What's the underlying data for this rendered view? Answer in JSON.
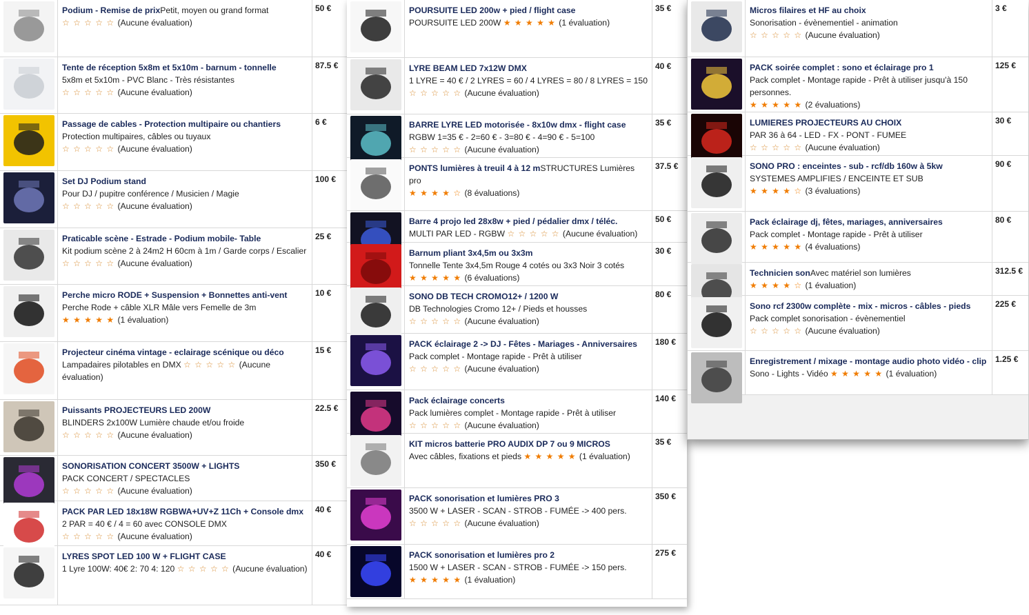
{
  "columns": [
    {
      "items": [
        {
          "title": "Podium - Remise de prix",
          "inline": "Petit, moyen ou grand format",
          "sub": "",
          "rating": "(Aucune évaluation)",
          "stars": 0,
          "price": "50 €",
          "thumb": "podium-thumbnail",
          "colors": [
            "#f4f4f4",
            "#888888"
          ]
        },
        {
          "title": "Tente de réception 5x8m et 5x10m - barnum - tonnelle",
          "inline": "",
          "sub": "5x8m et 5x10m - PVC Blanc - Très résistantes",
          "rating": "(Aucune évaluation)",
          "stars": 0,
          "price": "87.5 €",
          "thumb": "tent-thumbnail",
          "colors": [
            "#f2f3f5",
            "#c9ccd2"
          ]
        },
        {
          "title": "Passage de cables - Protection multipaire ou chantiers",
          "inline": "",
          "sub": "Protection multipaires, câbles ou tuyaux",
          "rating": "(Aucune évaluation)",
          "stars": 0,
          "price": "6 €",
          "thumb": "cable-protector-thumbnail",
          "colors": [
            "#f2c300",
            "#1c1c1c"
          ]
        },
        {
          "title": "Set DJ Podium stand",
          "inline": "",
          "sub": "Pour DJ / pupitre conférence / Musicien / Magie",
          "rating": "(Aucune évaluation)",
          "stars": 0,
          "price": "100 €",
          "thumb": "dj-stand-thumbnail",
          "colors": [
            "#1b1f3a",
            "#6f78b8"
          ]
        },
        {
          "title": "Praticable scène - Estrade - Podium mobile- Table",
          "inline": "",
          "sub": "Kit podium scène 2 à 24m2 H 60cm à 1m / Garde corps / Escalier",
          "rating": "(Aucune évaluation)",
          "stars": 0,
          "price": "25 €",
          "thumb": "stage-platform-thumbnail",
          "colors": [
            "#e9e9e9",
            "#333333"
          ]
        },
        {
          "title": "Perche micro RODE + Suspension + Bonnettes anti-vent",
          "inline": "",
          "sub": "Perche Rode + câble XLR Mâle vers Femelle de 3m",
          "rating": "(1 évaluation)",
          "stars": 5,
          "price": "10 €",
          "thumb": "boom-pole-thumbnail",
          "colors": [
            "#f0f0f0",
            "#111111"
          ]
        },
        {
          "title": "Projecteur cinéma vintage - eclairage scénique ou déco",
          "inline": "",
          "sub": "Lampadaires pilotables en DMX",
          "rating": "(Aucune évaluation)",
          "stars": 0,
          "price": "15 €",
          "thumb": "vintage-projector-thumbnail",
          "colors": [
            "#f6f6f6",
            "#e14a1f"
          ],
          "subInline": true
        },
        {
          "title": "Puissants PROJECTEURS LED 200W",
          "inline": "",
          "sub": "BLINDERS 2x100W Lumière chaude et/ou froide",
          "rating": "(Aucune évaluation)",
          "stars": 0,
          "price": "22.5 €",
          "thumb": "led-projector-thumbnail",
          "colors": [
            "#cfc6b8",
            "#3a342c"
          ]
        },
        {
          "title": "SONORISATION CONCERT 3500W + LIGHTS",
          "inline": "",
          "sub": "PACK CONCERT / SPECTACLES",
          "rating": "(Aucune évaluation)",
          "stars": 0,
          "price": "350 €",
          "thumb": "mixing-desk-thumbnail",
          "colors": [
            "#2a2a34",
            "#b03bd6"
          ]
        },
        {
          "title": "PACK PAR LED 18x18W RGBWA+UV+Z 11Ch + Console dmx",
          "inline": "",
          "sub": "2 PAR = 40 € / 4 = 60 avec CONSOLE DMX",
          "rating": "(Aucune évaluation)",
          "stars": 0,
          "price": "40 €",
          "thumb": "par-led-thumbnail",
          "colors": [
            "#ffffff",
            "#d02a2a"
          ]
        },
        {
          "title": "LYRES SPOT LED 100 W + FLIGHT CASE",
          "inline": "",
          "sub": "1 Lyre 100W: 40€ 2: 70 4: 120",
          "rating": "(Aucune évaluation)",
          "stars": 0,
          "price": "40 €",
          "thumb": "moving-head-thumbnail",
          "colors": [
            "#f5f5f5",
            "#1e1e1e"
          ],
          "subInline": true
        }
      ]
    },
    {
      "items": [
        {
          "title": "POURSUITE LED 200w + pied / flight case",
          "inline": "",
          "sub": "POURSUITE LED 200W",
          "rating": "(1 évaluation)",
          "stars": 5,
          "price": "35 €",
          "thumb": "followspot-thumbnail",
          "colors": [
            "#f7f7f7",
            "#1d1d1d"
          ],
          "subInline": true
        },
        {
          "title": "LYRE BEAM LED 7x12W DMX",
          "inline": "",
          "sub": "1 LYRE = 40 € / 2 LYRES = 60 / 4 LYRES = 80 / 8 LYRES = 150",
          "rating": "(Aucune évaluation)",
          "stars": 0,
          "price": "40 €",
          "thumb": "beam-lyre-thumbnail",
          "colors": [
            "#e9e9e9",
            "#262626"
          ]
        },
        {
          "title": "BARRE LYRE LED motorisée - 8x10w dmx - flight case",
          "inline": "",
          "sub": "RGBW 1=35 € - 2=60 € - 3=80 € - 4=90 € - 5=100",
          "rating": "(Aucune évaluation)",
          "stars": 0,
          "price": "35 €",
          "thumb": "led-bar-thumbnail",
          "colors": [
            "#0f1a28",
            "#5cc0c8"
          ]
        },
        {
          "title": "PONTS lumières à treuil 4 à 12 m",
          "inline": "STRUCTURES Lumières pro",
          "sub": "",
          "rating": "(8 évaluations)",
          "stars": 4,
          "price": "37.5 €",
          "thumb": "truss-thumbnail",
          "colors": [
            "#fafafa",
            "#555555"
          ]
        },
        {
          "title": "Barre 4 projo led 28x8w + pied / pédalier dmx / téléc.",
          "inline": "",
          "sub": "MULTI PAR LED - RGBW",
          "rating": "(Aucune évaluation)",
          "stars": 0,
          "price": "50 €",
          "thumb": "par-bar-thumbnail",
          "colors": [
            "#121222",
            "#3b5bd9"
          ],
          "subInline": true
        },
        {
          "title": "Barnum pliant 3x4,5m ou 3x3m",
          "inline": "",
          "sub": "Tonnelle Tente 3x4,5m Rouge 4 cotés ou 3x3 Noir 3 cotés",
          "rating": "(6 évaluations)",
          "stars": 5,
          "price": "30 €",
          "thumb": "red-tent-thumbnail",
          "colors": [
            "#d21a1a",
            "#7a0b0b"
          ]
        },
        {
          "title": "SONO DB TECH CROMO12+ / 1200 W",
          "inline": "",
          "sub": "DB Technologies Cromo 12+ / Pieds et housses",
          "rating": "(Aucune évaluation)",
          "stars": 0,
          "price": "80 €",
          "thumb": "speakers-thumbnail",
          "colors": [
            "#efefef",
            "#1a1a1a"
          ]
        },
        {
          "title": "PACK éclairage 2 -> DJ - Fêtes - Mariages - Anniversaires",
          "inline": "",
          "sub": "Pack complet - Montage rapide - Prêt à utiliser",
          "rating": "(Aucune évaluation)",
          "stars": 0,
          "price": "180 €",
          "thumb": "party-lights-thumbnail",
          "colors": [
            "#1b1144",
            "#8b5cf0"
          ]
        },
        {
          "title": "Pack éclairage concerts",
          "inline": "",
          "sub": "Pack lumières complet - Montage rapide - Prêt à utiliser",
          "rating": "(Aucune évaluation)",
          "stars": 0,
          "price": "140 €",
          "thumb": "concert-lights-thumbnail",
          "colors": [
            "#160b2b",
            "#e23a8a"
          ]
        },
        {
          "title": "KIT micros batterie PRO AUDIX DP 7 ou 9 MICROS",
          "inline": "",
          "sub": "Avec câbles, fixations et pieds",
          "rating": "(1 évaluation)",
          "stars": 5,
          "price": "35 €",
          "thumb": "drum-kit-thumbnail",
          "colors": [
            "#f2f2f2",
            "#777777"
          ],
          "subInline": true
        },
        {
          "title": "PACK sonorisation et lumières PRO 3",
          "inline": "",
          "sub": "3500 W + LASER - SCAN - STROB - FUMÉE -> 400 pers.",
          "rating": "(Aucune évaluation)",
          "stars": 0,
          "price": "350 €",
          "thumb": "laser-show-thumbnail",
          "colors": [
            "#3a0b4a",
            "#e43fd2"
          ]
        },
        {
          "title": "PACK sonorisation et lumières pro 2",
          "inline": "",
          "sub": "1500 W + LASER - SCAN - STROB - FUMÉE -> 150 pers.",
          "rating": "(1 évaluation)",
          "stars": 5,
          "price": "275 €",
          "thumb": "stage-blue-thumbnail",
          "colors": [
            "#07072a",
            "#3a49ff"
          ]
        }
      ]
    },
    {
      "items": [
        {
          "title": "Micros filaires et HF au choix",
          "inline": "",
          "sub": "Sonorisation - évènementiel - animation",
          "rating": "(Aucune évaluation)",
          "stars": 0,
          "price": "3 €",
          "thumb": "microphone-thumbnail",
          "colors": [
            "#e9e9e9",
            "#1d2b4a"
          ]
        },
        {
          "title": "PACK soirée complet : sono et éclairage pro 1",
          "inline": "",
          "sub": "Pack complet - Montage rapide - Prêt à utiliser jusqu'à 150 personnes.",
          "rating": "(2 évaluations)",
          "stars": 5,
          "price": "125 €",
          "thumb": "laser-rays-thumbnail",
          "colors": [
            "#1b0f2a",
            "#f2c83a"
          ]
        },
        {
          "title": "LUMIERES PROJECTEURS AU CHOIX",
          "inline": "",
          "sub": "PAR 36 à 64 - LED - FX - PONT - FUMEE",
          "rating": "(Aucune évaluation)",
          "stars": 0,
          "price": "30 €",
          "thumb": "red-par-thumbnail",
          "colors": [
            "#1a0505",
            "#d8281e"
          ]
        },
        {
          "title": "SONO PRO : enceintes - sub - rcf/db 160w à 5kw",
          "inline": "",
          "sub": "SYSTEMES AMPLIFIES / ENCEINTE ET SUB",
          "rating": "(3 évaluations)",
          "stars": 4,
          "price": "90 €",
          "thumb": "pa-system-thumbnail",
          "colors": [
            "#efefef",
            "#151515"
          ]
        },
        {
          "title": "Pack éclairage dj, fêtes, mariages, anniversaires",
          "inline": "",
          "sub": "Pack complet - Montage rapide - Prêt à utiliser",
          "rating": "(4 évaluations)",
          "stars": 5,
          "price": "80 €",
          "thumb": "dj-light-thumbnail",
          "colors": [
            "#ececec",
            "#2a2a2a"
          ]
        },
        {
          "title": "Technicien son",
          "inline": "Avec matériel son lumières",
          "sub": "",
          "rating": "(1 évaluation)",
          "stars": 4,
          "price": "312.5 €",
          "thumb": "flight-case-thumbnail",
          "colors": [
            "#e5e5e5",
            "#333333"
          ]
        },
        {
          "title": "Sono rcf 2300w complète - mix - micros - câbles - pieds",
          "inline": "",
          "sub": "Pack complet sonorisation - évènementiel",
          "rating": "(Aucune évaluation)",
          "stars": 0,
          "price": "225 €",
          "thumb": "rcf-speakers-thumbnail",
          "colors": [
            "#f0f0f0",
            "#101010"
          ]
        },
        {
          "title": "Enregistrement / mixage - montage audio photo vidéo - clip",
          "inline": "",
          "sub": "Sono - Lights - Vidéo",
          "rating": "(1 évaluation)",
          "stars": 5,
          "price": "1.25 €",
          "thumb": "studio-console-thumbnail",
          "colors": [
            "#bdbdbd",
            "#3a3a3a"
          ],
          "subInline": true
        }
      ]
    }
  ],
  "star_full": "★",
  "star_empty": "☆",
  "star_color": "#f07c00"
}
